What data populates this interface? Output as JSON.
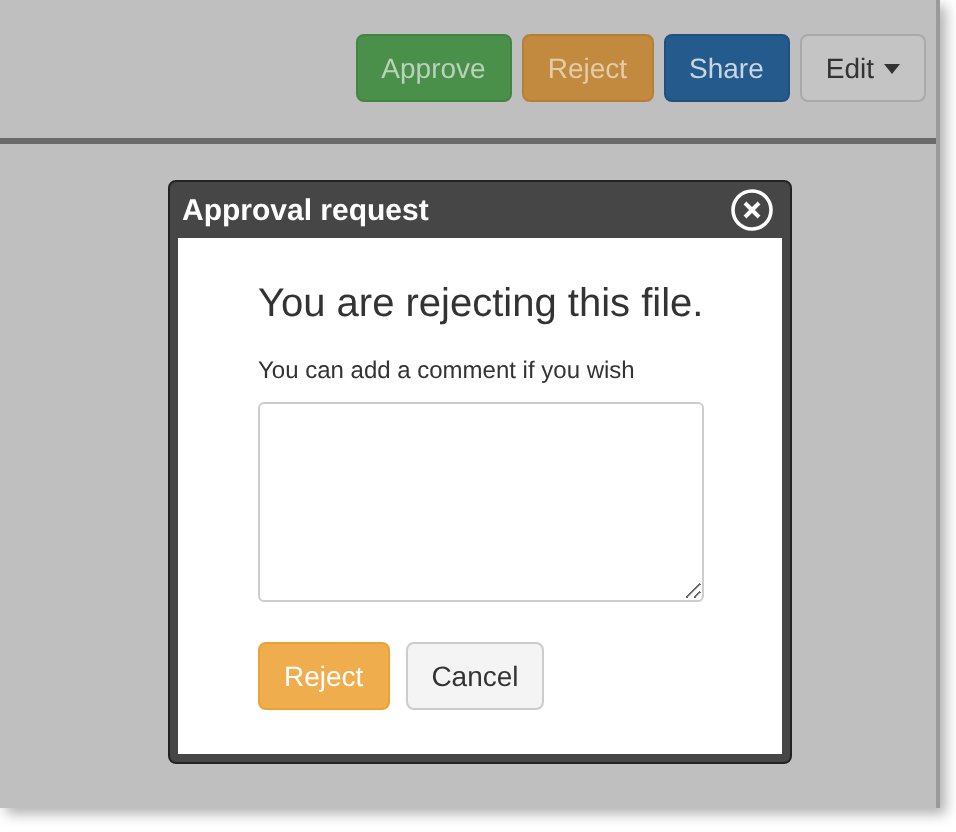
{
  "toolbar": {
    "buttons": [
      {
        "label": "Approve",
        "kind": "success",
        "dropdown": false
      },
      {
        "label": "Reject",
        "kind": "warning",
        "dropdown": false
      },
      {
        "label": "Share",
        "kind": "primary",
        "dropdown": false
      },
      {
        "label": "Edit",
        "kind": "default",
        "dropdown": true
      }
    ]
  },
  "dialog": {
    "title": "Approval request",
    "heading": "You are rejecting this file.",
    "comment_label": "You can add a comment if you wish",
    "buttons": [
      {
        "label": "Reject",
        "kind": "warning"
      },
      {
        "label": "Cancel",
        "kind": "default"
      }
    ]
  }
}
